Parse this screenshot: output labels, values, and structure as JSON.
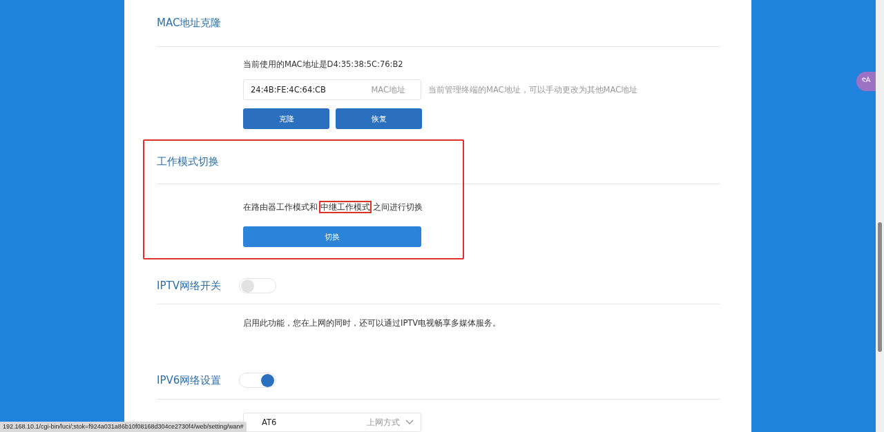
{
  "sections": [
    {
      "kind": "mac",
      "title": "MAC地址克隆",
      "current": "当前使用的MAC地址是D4:35:38:5C:76:B2",
      "field": {
        "value": "24:4B:FE:4C:64:CB",
        "label": "MAC地址"
      },
      "hint": "当前管理终端的MAC地址，可以手动更改为其他MAC地址",
      "buttons": [
        "克隆",
        "恢复"
      ]
    },
    {
      "kind": "mode",
      "title": "工作模式切换",
      "annotated": true,
      "description": {
        "before": "在路由器工作模式和",
        "highlighted": "中继工作模式",
        "after": "之间进行切换"
      },
      "button": "切换"
    },
    {
      "kind": "toggle",
      "title": "IPTV网络开关",
      "on": false,
      "description": "启用此功能，您在上网的同时，还可以通过IPTV电视畅享多媒体服务。"
    },
    {
      "kind": "toggle",
      "title": "IPV6网络设置",
      "on": true,
      "select": {
        "value": "AT6",
        "label": "上网方式"
      }
    }
  ],
  "status_bar": "192.168.10.1/cgi-bin/luci/;stok=f924a031a86b10f08168d304ce2730f4/web/setting/wan#"
}
